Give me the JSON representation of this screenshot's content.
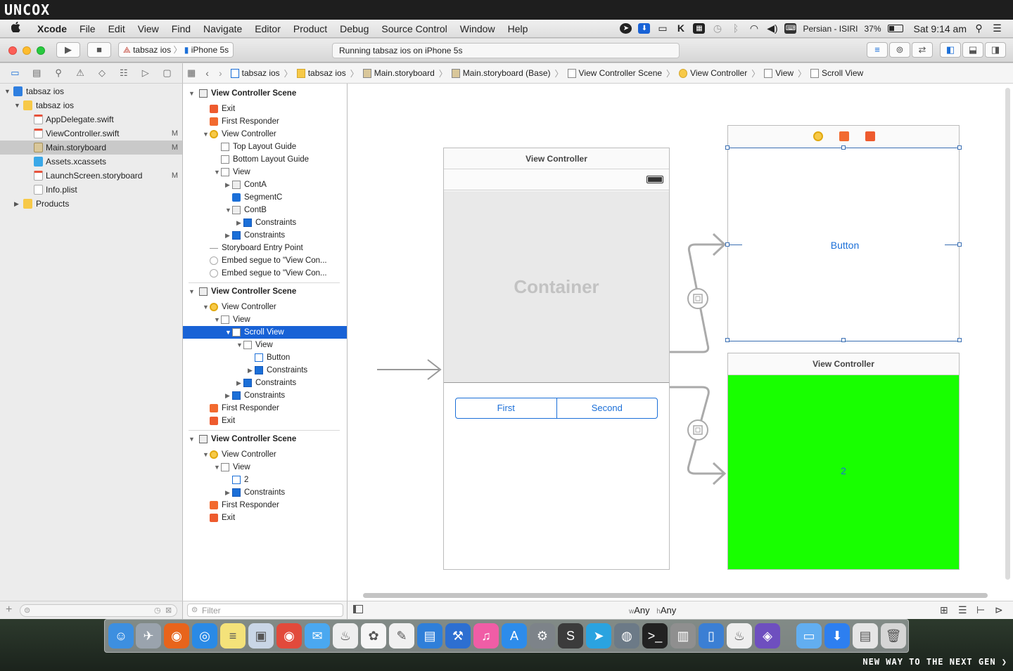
{
  "watermark": {
    "logo": "UNCOX",
    "tagline": "NEW WAY TO THE NEXT GEN ❯"
  },
  "menubar": {
    "apple": "",
    "items": [
      "Xcode",
      "File",
      "Edit",
      "View",
      "Find",
      "Navigate",
      "Editor",
      "Product",
      "Debug",
      "Source Control",
      "Window",
      "Help"
    ],
    "input_source": "Persian - ISIRI",
    "battery": "37%",
    "clock": "Sat 9:14 am"
  },
  "toolbar": {
    "scheme_target": "tabsaz ios",
    "scheme_device": "iPhone 5s",
    "activity": "Running tabsaz ios on iPhone 5s"
  },
  "jumpbar": {
    "items": [
      "tabsaz ios",
      "tabsaz ios",
      "Main.storyboard",
      "Main.storyboard (Base)",
      "View Controller Scene",
      "View Controller",
      "View",
      "Scroll View"
    ]
  },
  "project_nav": {
    "rows": [
      {
        "label": "tabsaz ios",
        "badge": ""
      },
      {
        "label": "tabsaz ios",
        "badge": ""
      },
      {
        "label": "AppDelegate.swift",
        "badge": ""
      },
      {
        "label": "ViewController.swift",
        "badge": "M"
      },
      {
        "label": "Main.storyboard",
        "badge": "M"
      },
      {
        "label": "Assets.xcassets",
        "badge": ""
      },
      {
        "label": "LaunchScreen.storyboard",
        "badge": "M"
      },
      {
        "label": "Info.plist",
        "badge": ""
      },
      {
        "label": "Products",
        "badge": ""
      }
    ]
  },
  "outline": {
    "rows": [
      {
        "label": "View Controller Scene",
        "icon": "scene"
      },
      {
        "label": "Exit",
        "icon": "exit"
      },
      {
        "label": "First Responder",
        "icon": "responder"
      },
      {
        "label": "View Controller",
        "icon": "vc"
      },
      {
        "label": "Top Layout Guide",
        "icon": "view"
      },
      {
        "label": "Bottom Layout Guide",
        "icon": "view"
      },
      {
        "label": "View",
        "icon": "view"
      },
      {
        "label": "ContA",
        "icon": "container"
      },
      {
        "label": "SegmentC",
        "icon": "segment"
      },
      {
        "label": "ContB",
        "icon": "container"
      },
      {
        "label": "Constraints",
        "icon": "constraints"
      },
      {
        "label": "Constraints",
        "icon": "constraints"
      },
      {
        "label": "Storyboard Entry Point",
        "icon": "arrow"
      },
      {
        "label": "Embed segue to \"View Con...",
        "icon": "segue"
      },
      {
        "label": "Embed segue to \"View Con...",
        "icon": "segue"
      },
      {
        "label": "View Controller Scene",
        "icon": "scene"
      },
      {
        "label": "View Controller",
        "icon": "vc"
      },
      {
        "label": "View",
        "icon": "view"
      },
      {
        "label": "Scroll View",
        "icon": "view"
      },
      {
        "label": "View",
        "icon": "view"
      },
      {
        "label": "Button",
        "icon": "button"
      },
      {
        "label": "Constraints",
        "icon": "constraints"
      },
      {
        "label": "Constraints",
        "icon": "constraints"
      },
      {
        "label": "Constraints",
        "icon": "constraints"
      },
      {
        "label": "First Responder",
        "icon": "responder"
      },
      {
        "label": "Exit",
        "icon": "exit"
      },
      {
        "label": "View Controller Scene",
        "icon": "scene"
      },
      {
        "label": "View Controller",
        "icon": "vc"
      },
      {
        "label": "View",
        "icon": "view"
      },
      {
        "label": "2",
        "icon": "button"
      },
      {
        "label": "Constraints",
        "icon": "constraints"
      },
      {
        "label": "First Responder",
        "icon": "responder"
      },
      {
        "label": "Exit",
        "icon": "exit"
      }
    ]
  },
  "canvas": {
    "main_vc": {
      "title": "View Controller",
      "container_label": "Container",
      "segments": [
        "First",
        "Second"
      ]
    },
    "top_right": {
      "button_label": "Button"
    },
    "bottom_right": {
      "title": "View Controller",
      "label": "2",
      "bg": "#18ff00"
    }
  },
  "bottom": {
    "filter_placeholder": "Filter",
    "size_w_prefix": "w",
    "size_w": "Any",
    "size_h_prefix": "h",
    "size_h": "Any"
  },
  "colors": {
    "selection": "#1862d6",
    "accent": "#1b6fd8",
    "green": "#18ff00"
  }
}
